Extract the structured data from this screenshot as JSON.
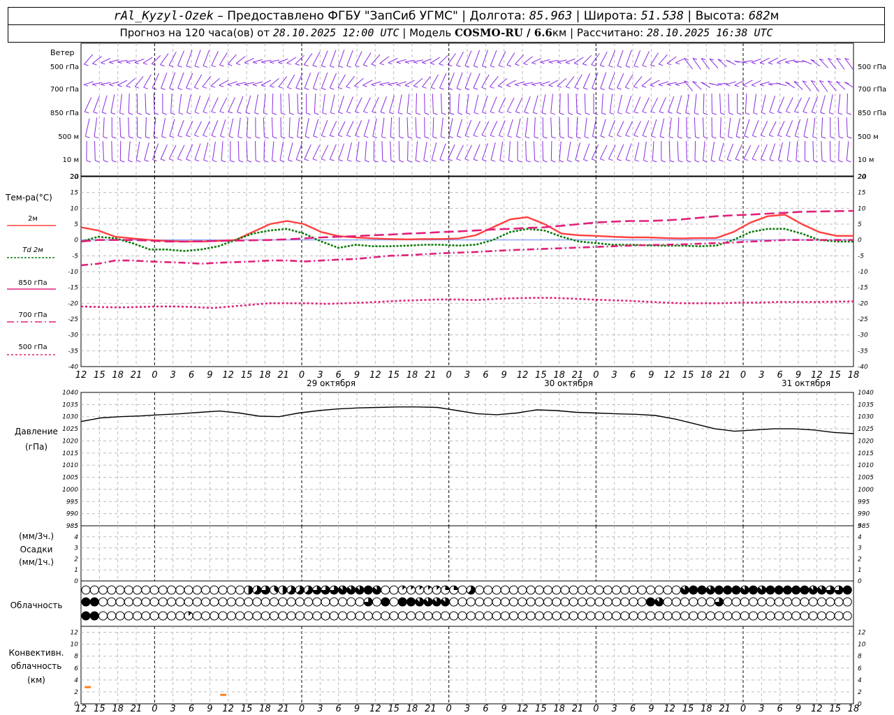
{
  "header": {
    "station": "rAl_Kyzyl-Ozek",
    "dash": " – ",
    "provider": "Предоставлено ФГБУ \"ЗапСиб УГМС\"",
    "sep": " | ",
    "lon_label": "Долгота: ",
    "lon": "85.963",
    "lat_label": "Широта: ",
    "lat": "51.538",
    "alt_label": "Высота: ",
    "alt": "682",
    "alt_unit": "м",
    "forecast_label": "Прогноз на 120 часа(ов) от ",
    "forecast_start": "28.10.2025 12:00 UTC",
    "model_label": "Модель ",
    "model": "COSMO-RU / 6.6",
    "model_unit": "км",
    "calc_label": "Рассчитано: ",
    "calc_time": "28.10.2025 16:38 UTC"
  },
  "wind": {
    "title": "Ветер",
    "levels": [
      "500 гПа",
      "700 гПа",
      "850 гПа",
      "500 м",
      "10 м"
    ],
    "right_levels": [
      "500 гПа",
      "700 гПа",
      "850 гПа",
      "500 м",
      "10 м"
    ],
    "bottom_tick": "20",
    "right_bottom_tick": "20",
    "color": "#8a2be2"
  },
  "temp_panel": {
    "title": "Тем-ра(°C)",
    "legend": [
      {
        "label": "2м",
        "color": "#ff4040",
        "dash": ""
      },
      {
        "label": "Td 2м",
        "color": "#0a7a0a",
        "dash": "3,2"
      },
      {
        "label": "850 гПа",
        "color": "#e0207a",
        "dash": "14,6"
      },
      {
        "label": "700 гПа",
        "color": "#e0207a",
        "dash": "10,4,2,4"
      },
      {
        "label": "500 гПа",
        "color": "#e0207a",
        "dash": "3,3"
      }
    ]
  },
  "pressure_panel": {
    "title": "Давление",
    "unit": "(гПа)"
  },
  "precip_panel": {
    "unit1": "(мм/3ч.)",
    "title": "Осадки",
    "unit2": "(мм/1ч.)"
  },
  "cloud_panel": {
    "title": "Облачность"
  },
  "conv_panel": {
    "title1": "Конвективн.",
    "title2": "облачность",
    "unit": "(км)"
  },
  "dates": [
    "29 октября",
    "30 октября",
    "31 октября"
  ],
  "chart_data": [
    {
      "type": "line",
      "name": "temperature",
      "x_hours": [
        0,
        3,
        6,
        9,
        12,
        15,
        18,
        21,
        24,
        27,
        30,
        33,
        36,
        39,
        42,
        45,
        48,
        51,
        54,
        57,
        60,
        63,
        66,
        69,
        72,
        75,
        78,
        81,
        84,
        87,
        90,
        93,
        96,
        99,
        102,
        105,
        108,
        111,
        114,
        117,
        120,
        123,
        126
      ],
      "x_tick_labels": [
        "12",
        "15",
        "18",
        "21",
        "0",
        "3",
        "6",
        "9",
        "12",
        "15",
        "18",
        "21",
        "0",
        "3",
        "6",
        "9",
        "12",
        "15",
        "18",
        "21",
        "0",
        "3",
        "6",
        "9",
        "12",
        "15",
        "18",
        "21",
        "0",
        "3",
        "6",
        "9",
        "12",
        "15",
        "18",
        "21",
        "0",
        "3",
        "6",
        "9",
        "12",
        "15",
        "18"
      ],
      "ylim": [
        -40,
        20
      ],
      "yticks": [
        20,
        15,
        10,
        5,
        0,
        -5,
        -10,
        -15,
        -20,
        -25,
        -30,
        -35,
        -40
      ],
      "series": [
        {
          "name": "2м",
          "values": [
            4,
            3,
            1,
            0.5,
            0,
            -0.3,
            -0.5,
            -0.5,
            -0.3,
            0,
            2.5,
            5,
            6,
            5,
            2.5,
            1.2,
            0.8,
            0.5,
            0.3,
            0.2,
            0.3,
            0.3,
            0.5,
            1.5,
            4,
            6.5,
            7.2,
            5,
            2,
            1.5,
            1.3,
            1.0,
            0.8,
            0.8,
            0.6,
            0.5,
            0.6,
            0.6,
            2.5,
            5.5,
            7.5,
            8,
            5,
            2.5,
            1.3,
            1.3
          ]
        },
        {
          "name": "Td 2м",
          "values": [
            -0.5,
            1,
            0.5,
            -1,
            -3,
            -3,
            -3.5,
            -3,
            -2,
            0,
            2,
            3,
            3.5,
            2,
            -0.5,
            -2.5,
            -1.5,
            -2,
            -2,
            -1.8,
            -1.5,
            -1.5,
            -1.8,
            -1.5,
            0,
            2.5,
            3.5,
            3,
            1,
            -0.5,
            -1,
            -1.5,
            -1.5,
            -1.7,
            -1.8,
            -1.8,
            -2,
            -1.8,
            0,
            2.5,
            3.5,
            3.5,
            2,
            0,
            -0.5,
            -0.5
          ]
        },
        {
          "name": "850 гПа",
          "values": [
            -0.5,
            0,
            0,
            0,
            -0.2,
            -0.5,
            -0.5,
            -0.4,
            -0.3,
            -0.2,
            -0.1,
            0,
            0.2,
            0.5,
            0.8,
            1,
            1.2,
            1.5,
            1.7,
            2,
            2.2,
            2.5,
            2.7,
            3,
            3.3,
            3.5,
            3.8,
            4,
            4.5,
            5,
            5.5,
            5.8,
            6,
            6,
            6.2,
            6.5,
            7,
            7.5,
            7.8,
            8,
            8.3,
            8.6,
            8.9,
            9,
            9.1,
            9.2
          ]
        },
        {
          "name": "700 гПа",
          "values": [
            -8,
            -7.5,
            -6.5,
            -6.5,
            -6.8,
            -7,
            -7.2,
            -7.5,
            -7.2,
            -7,
            -6.8,
            -6.5,
            -6.5,
            -6.8,
            -6.5,
            -6.2,
            -6,
            -5.5,
            -5,
            -4.8,
            -4.5,
            -4.2,
            -4,
            -3.8,
            -3.5,
            -3.2,
            -3,
            -2.8,
            -2.6,
            -2.4,
            -2.2,
            -2,
            -1.8,
            -1.6,
            -1.5,
            -1.4,
            -1.2,
            -1,
            -0.8,
            -0.5,
            -0.3,
            0,
            0,
            0,
            0,
            0
          ]
        },
        {
          "name": "500 гПа",
          "values": [
            -21,
            -21.2,
            -21.3,
            -21.2,
            -21,
            -21,
            -21.2,
            -21.5,
            -21,
            -20.5,
            -20,
            -20,
            -20,
            -20.2,
            -20,
            -19.8,
            -19.5,
            -19.2,
            -19,
            -18.8,
            -18.8,
            -19,
            -18.6,
            -18.4,
            -18.3,
            -18.3,
            -18.5,
            -18.8,
            -19,
            -19.2,
            -19.5,
            -19.8,
            -20,
            -20,
            -20,
            -19.8,
            -19.8,
            -19.6,
            -19.6,
            -19.6,
            -19.5,
            -19.4
          ]
        }
      ]
    },
    {
      "type": "line",
      "name": "pressure",
      "ylim": [
        985,
        1040
      ],
      "yticks": [
        1040,
        1035,
        1030,
        1025,
        1020,
        1015,
        1010,
        1005,
        1000,
        995,
        990,
        985
      ],
      "series": [
        {
          "name": "pressure",
          "values": [
            1028,
            1029.5,
            1030,
            1030.3,
            1030.8,
            1031.2,
            1031.8,
            1032.3,
            1031.5,
            1030.2,
            1030,
            1031.5,
            1032.5,
            1033.2,
            1033.6,
            1033.8,
            1034,
            1034,
            1033.8,
            1032.5,
            1031.2,
            1030.8,
            1031.5,
            1032.8,
            1032.5,
            1031.8,
            1031.5,
            1031.2,
            1031,
            1030.5,
            1029,
            1027,
            1025,
            1024,
            1024.5,
            1025,
            1025,
            1024.5,
            1023.5,
            1023
          ]
        }
      ]
    },
    {
      "type": "bar",
      "name": "precipitation",
      "ylim": [
        0,
        5
      ],
      "yticks": [
        5,
        4,
        3,
        2,
        1,
        0
      ],
      "values": []
    },
    {
      "type": "bar",
      "name": "convective_cloud",
      "ylim": [
        0,
        13
      ],
      "yticks": [
        12,
        10,
        8,
        6,
        4,
        2,
        0
      ],
      "segments": [
        {
          "x_start": 0.6,
          "x_end": 1.6,
          "y": 2.8,
          "color": "#ff7f1a"
        },
        {
          "x_start": 22.7,
          "x_end": 23.7,
          "y": 1.5,
          "color": "#ff7f1a"
        }
      ]
    }
  ],
  "clouds": {
    "row1": "0000000000000000000456345556667778700111112205000000000000000000000000789788878799888776689",
    "row2": "8800000000000000000000000000000006080887777000000000000000000000008700000060000000000000000",
    "row3": "8800000000001000000000000000000000000000000000000000000000000000000000000000000000000000000"
  }
}
